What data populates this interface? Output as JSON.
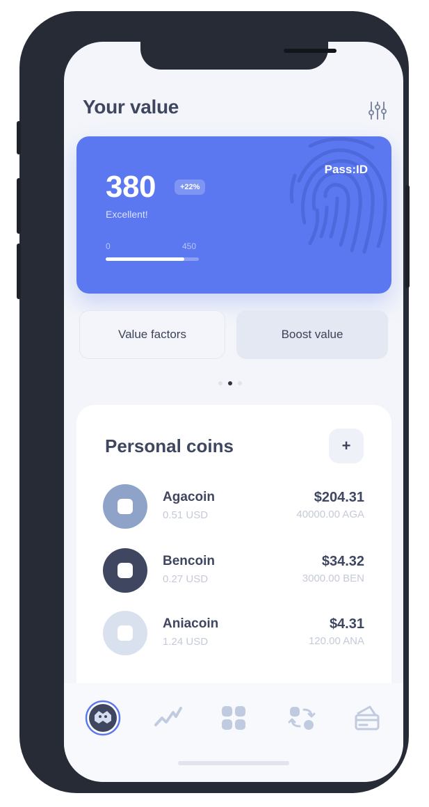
{
  "header": {
    "title": "Your value",
    "settings_icon": "sliders-icon"
  },
  "score_card": {
    "pass_label": "Pass:ID",
    "score": "380",
    "change": "+22%",
    "rating": "Excellent!",
    "range_min": "0",
    "range_max": "450",
    "progress_fraction": 0.844,
    "accent": "#5b78f0"
  },
  "actions": {
    "factors_label": "Value factors",
    "boost_label": "Boost value"
  },
  "pager": {
    "count": 3,
    "active": 1
  },
  "coins": {
    "title": "Personal coins",
    "add_label": "+",
    "items": [
      {
        "name": "Agacoin",
        "usd": "0.51 USD",
        "value": "$204.31",
        "holding": "40000.00 AGA",
        "color": "#8fa3c9"
      },
      {
        "name": "Bencoin",
        "usd": "0.27 USD",
        "value": "$34.32",
        "holding": "3000.00 BEN",
        "color": "#3e4660"
      },
      {
        "name": "Aniacoin",
        "usd": "1.24 USD",
        "value": "$4.31",
        "holding": "120.00 ANA",
        "color": "#d9e1ef"
      }
    ]
  },
  "tabbar": {
    "tabs": [
      {
        "name": "avatar-icon",
        "active": true
      },
      {
        "name": "trend-chart-icon",
        "active": false
      },
      {
        "name": "grid-icon",
        "active": false
      },
      {
        "name": "exchange-icon",
        "active": false
      },
      {
        "name": "card-icon",
        "active": false
      }
    ]
  }
}
